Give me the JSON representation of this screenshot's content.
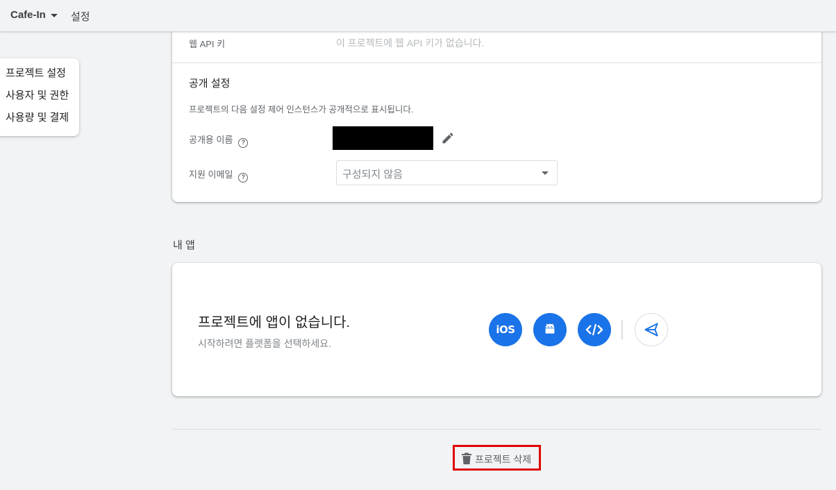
{
  "topbar": {
    "project_name": "Cafe-In",
    "breadcrumb": "설정"
  },
  "sidemenu": {
    "items": [
      {
        "label": "프로젝트 설정"
      },
      {
        "label": "사용자 및 권한"
      },
      {
        "label": "사용량 및 결제"
      }
    ]
  },
  "settings": {
    "web_api_key_label": "웹 API 키",
    "web_api_key_value": "이 프로젝트에 웹 API 키가 없습니다.",
    "public_section_title": "공개 설정",
    "public_section_desc": "프로젝트의 다음 설정 제어 인스턴스가 공개적으로 표시됩니다.",
    "public_name_label": "공개용 이름",
    "support_email_label": "지원 이메일",
    "support_email_value": "구성되지 않음",
    "help_glyph": "?"
  },
  "apps": {
    "heading": "내 앱",
    "empty_title": "프로젝트에 앱이 없습니다.",
    "empty_subtitle": "시작하려면 플랫폼을 선택하세요.",
    "ios_label": "iOS",
    "platforms": [
      "ios-icon",
      "android-icon",
      "web-code-icon",
      "unity-icon"
    ]
  },
  "danger": {
    "delete_label": "프로젝트 삭제"
  },
  "colors": {
    "primary": "#1a73e8",
    "highlight": "#e00000",
    "background": "#f1f3f4"
  }
}
